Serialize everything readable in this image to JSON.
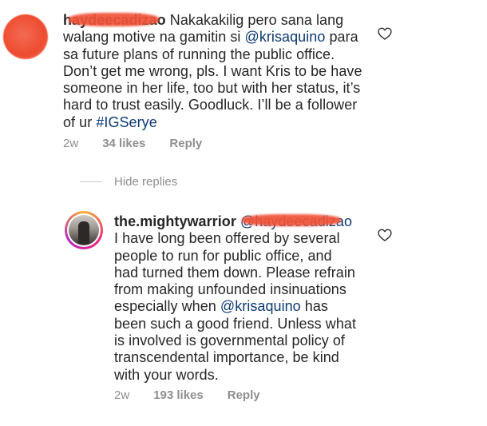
{
  "comment": {
    "username": "haydeecadizao",
    "text_runs": [
      {
        "text": "Nakakakilig pero sana lang walang motive na gamitin si ",
        "kind": "text"
      },
      {
        "text": "@krisaquino",
        "kind": "mention"
      },
      {
        "text": " para sa future plans of running the public office. Don’t get me wrong, pls. I want Kris to be have someone in her life, too but with her status, it’s hard to trust easily. Goodluck. I’ll be a follower of ur ",
        "kind": "text"
      },
      {
        "text": "#IGSerye",
        "kind": "mention"
      }
    ],
    "time": "2w",
    "likes": "34 likes",
    "reply_label": "Reply"
  },
  "hide_replies_label": "Hide replies",
  "reply": {
    "username": "the.mightywarrior",
    "mention": "@haydeecadizao",
    "text_runs": [
      {
        "text": "I have long been offered by several people to run for public office, and had turned them down. Please refrain from making unfounded insinuations especially when ",
        "kind": "text"
      },
      {
        "text": "@krisaquino",
        "kind": "mention"
      },
      {
        "text": " has been such a good friend. Unless what is involved is governmental policy of transcendental importance, be kind with your words.",
        "kind": "text"
      }
    ],
    "time": "2w",
    "likes": "193 likes",
    "reply_label": "Reply"
  },
  "colors": {
    "text": "#262626",
    "mention": "#0c3a72",
    "muted": "#8e8e8e",
    "redaction": "#f0533a"
  },
  "icons": {
    "like": "heart-outline-icon"
  }
}
